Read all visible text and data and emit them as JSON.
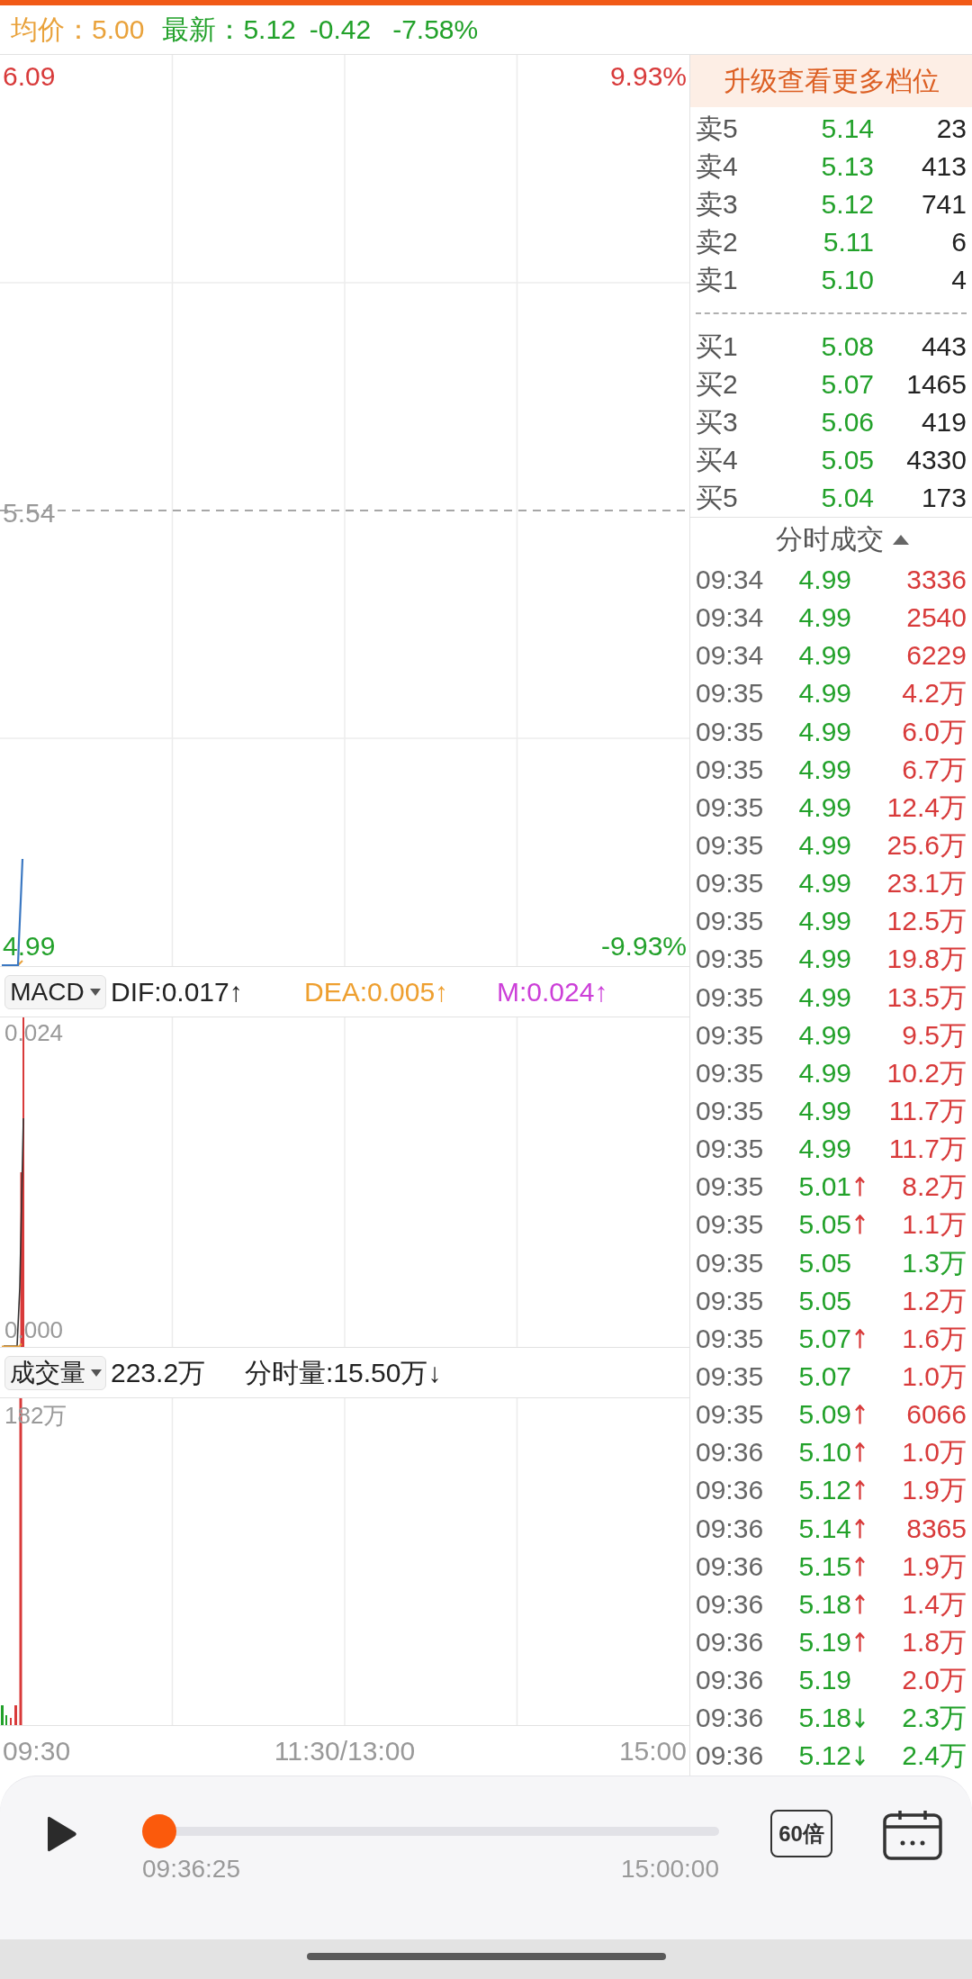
{
  "header": {
    "average": "均价：5.00",
    "latest": "最新：5.12",
    "change": "-0.42",
    "change_percent": "-7.58%"
  },
  "price_chart": {
    "high": "6.09",
    "high_percent": "9.93%",
    "reference": "5.54",
    "low": "4.99",
    "low_percent": "-9.93%"
  },
  "macd": {
    "selector": "MACD",
    "dif": "DIF:0.017↑",
    "dea": "DEA:0.005↑",
    "m": "M:0.024↑",
    "max_label": "0.024",
    "min_label": "0.000"
  },
  "volume": {
    "selector": "成交量",
    "total": "223.2万",
    "minute": "分时量:15.50万↓",
    "max_label": "182万"
  },
  "time_axis": [
    "09:30",
    "11:30/13:00",
    "15:00"
  ],
  "order_book": {
    "upgrade": "升级查看更多档位",
    "asks": [
      {
        "label": "卖5",
        "price": "5.14",
        "volume": "23"
      },
      {
        "label": "卖4",
        "price": "5.13",
        "volume": "413"
      },
      {
        "label": "卖3",
        "price": "5.12",
        "volume": "741"
      },
      {
        "label": "卖2",
        "price": "5.11",
        "volume": "6"
      },
      {
        "label": "卖1",
        "price": "5.10",
        "volume": "4"
      }
    ],
    "bids": [
      {
        "label": "买1",
        "price": "5.08",
        "volume": "443"
      },
      {
        "label": "买2",
        "price": "5.07",
        "volume": "1465"
      },
      {
        "label": "买3",
        "price": "5.06",
        "volume": "419"
      },
      {
        "label": "买4",
        "price": "5.05",
        "volume": "4330"
      },
      {
        "label": "买5",
        "price": "5.04",
        "volume": "173"
      }
    ]
  },
  "trades": {
    "title": "分时成交",
    "rows": [
      {
        "time": "09:34",
        "price": "4.99",
        "up_tick": false,
        "down_tick": false,
        "volume": "3336",
        "color": "#d83a3a"
      },
      {
        "time": "09:34",
        "price": "4.99",
        "up_tick": false,
        "down_tick": false,
        "volume": "2540",
        "color": "#d83a3a"
      },
      {
        "time": "09:34",
        "price": "4.99",
        "up_tick": false,
        "down_tick": false,
        "volume": "6229",
        "color": "#d83a3a"
      },
      {
        "time": "09:35",
        "price": "4.99",
        "up_tick": false,
        "down_tick": false,
        "volume": "4.2万",
        "color": "#d83a3a"
      },
      {
        "time": "09:35",
        "price": "4.99",
        "up_tick": false,
        "down_tick": false,
        "volume": "6.0万",
        "color": "#d83a3a"
      },
      {
        "time": "09:35",
        "price": "4.99",
        "up_tick": false,
        "down_tick": false,
        "volume": "6.7万",
        "color": "#d83a3a"
      },
      {
        "time": "09:35",
        "price": "4.99",
        "up_tick": false,
        "down_tick": false,
        "volume": "12.4万",
        "color": "#d83a3a"
      },
      {
        "time": "09:35",
        "price": "4.99",
        "up_tick": false,
        "down_tick": false,
        "volume": "25.6万",
        "color": "#d83a3a"
      },
      {
        "time": "09:35",
        "price": "4.99",
        "up_tick": false,
        "down_tick": false,
        "volume": "23.1万",
        "color": "#d83a3a"
      },
      {
        "time": "09:35",
        "price": "4.99",
        "up_tick": false,
        "down_tick": false,
        "volume": "12.5万",
        "color": "#d83a3a"
      },
      {
        "time": "09:35",
        "price": "4.99",
        "up_tick": false,
        "down_tick": false,
        "volume": "19.8万",
        "color": "#d83a3a"
      },
      {
        "time": "09:35",
        "price": "4.99",
        "up_tick": false,
        "down_tick": false,
        "volume": "13.5万",
        "color": "#d83a3a"
      },
      {
        "time": "09:35",
        "price": "4.99",
        "up_tick": false,
        "down_tick": false,
        "volume": "9.5万",
        "color": "#d83a3a"
      },
      {
        "time": "09:35",
        "price": "4.99",
        "up_tick": false,
        "down_tick": false,
        "volume": "10.2万",
        "color": "#d83a3a"
      },
      {
        "time": "09:35",
        "price": "4.99",
        "up_tick": false,
        "down_tick": false,
        "volume": "11.7万",
        "color": "#d83a3a"
      },
      {
        "time": "09:35",
        "price": "4.99",
        "up_tick": false,
        "down_tick": false,
        "volume": "11.7万",
        "color": "#d83a3a"
      },
      {
        "time": "09:35",
        "price": "5.01",
        "up_tick": true,
        "down_tick": false,
        "volume": "8.2万",
        "color": "#d83a3a"
      },
      {
        "time": "09:35",
        "price": "5.05",
        "up_tick": true,
        "down_tick": false,
        "volume": "1.1万",
        "color": "#d83a3a"
      },
      {
        "time": "09:35",
        "price": "5.05",
        "up_tick": false,
        "down_tick": false,
        "volume": "1.3万",
        "color": "#22a12a"
      },
      {
        "time": "09:35",
        "price": "5.05",
        "up_tick": false,
        "down_tick": false,
        "volume": "1.2万",
        "color": "#d83a3a"
      },
      {
        "time": "09:35",
        "price": "5.07",
        "up_tick": true,
        "down_tick": false,
        "volume": "1.6万",
        "color": "#d83a3a"
      },
      {
        "time": "09:35",
        "price": "5.07",
        "up_tick": false,
        "down_tick": false,
        "volume": "1.0万",
        "color": "#d83a3a"
      },
      {
        "time": "09:35",
        "price": "5.09",
        "up_tick": true,
        "down_tick": false,
        "volume": "6066",
        "color": "#d83a3a"
      },
      {
        "time": "09:36",
        "price": "5.10",
        "up_tick": true,
        "down_tick": false,
        "volume": "1.0万",
        "color": "#d83a3a"
      },
      {
        "time": "09:36",
        "price": "5.12",
        "up_tick": true,
        "down_tick": false,
        "volume": "1.9万",
        "color": "#d83a3a"
      },
      {
        "time": "09:36",
        "price": "5.14",
        "up_tick": true,
        "down_tick": false,
        "volume": "8365",
        "color": "#d83a3a"
      },
      {
        "time": "09:36",
        "price": "5.15",
        "up_tick": true,
        "down_tick": false,
        "volume": "1.9万",
        "color": "#d83a3a"
      },
      {
        "time": "09:36",
        "price": "5.18",
        "up_tick": true,
        "down_tick": false,
        "volume": "1.4万",
        "color": "#d83a3a"
      },
      {
        "time": "09:36",
        "price": "5.19",
        "up_tick": true,
        "down_tick": false,
        "volume": "1.8万",
        "color": "#d83a3a"
      },
      {
        "time": "09:36",
        "price": "5.19",
        "up_tick": false,
        "down_tick": false,
        "volume": "2.0万",
        "color": "#d83a3a"
      },
      {
        "time": "09:36",
        "price": "5.18",
        "up_tick": false,
        "down_tick": true,
        "volume": "2.3万",
        "color": "#22a12a"
      },
      {
        "time": "09:36",
        "price": "5.12",
        "up_tick": false,
        "down_tick": true,
        "volume": "2.4万",
        "color": "#22a12a"
      }
    ]
  },
  "player": {
    "elapsed": "09:36:25",
    "end": "15:00:00",
    "level": 0.02,
    "speed": "60倍"
  }
}
